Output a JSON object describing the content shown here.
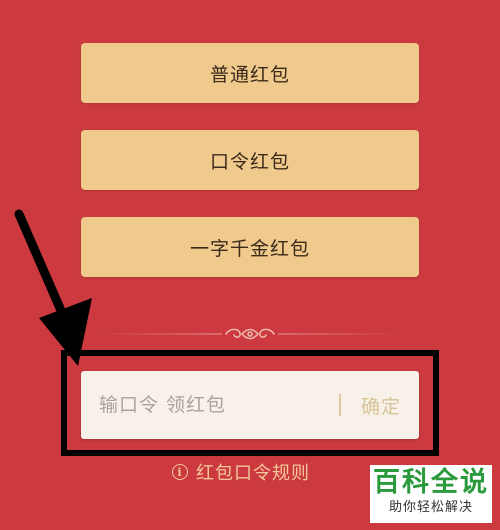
{
  "buttons": {
    "normal": "普通红包",
    "password": "口令红包",
    "one_word": "一字千金红包"
  },
  "code_input": {
    "placeholder": "输口令 领红包",
    "value": "",
    "confirm_label": "确定"
  },
  "rules_link": {
    "icon": "info-icon",
    "icon_glyph": "i",
    "label": "红包口令规则"
  },
  "watermark": {
    "title": "百科全说",
    "subtitle": "助你轻松解决"
  },
  "colors": {
    "background": "#cc3a40",
    "button_fill": "#f0ca8c",
    "input_fill": "#f7f1ea",
    "link_text": "#f3c89a",
    "annotation": "#000000",
    "watermark_green": "#2a9a3c"
  }
}
